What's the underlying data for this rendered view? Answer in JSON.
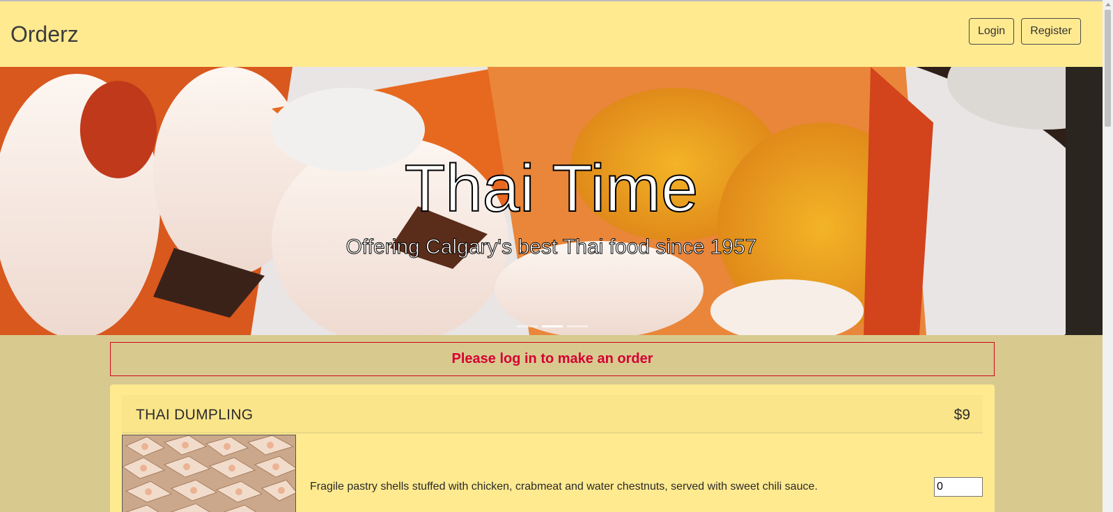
{
  "navbar": {
    "brand": "Orderz",
    "login_label": "Login",
    "register_label": "Register"
  },
  "hero": {
    "title": "Thai Time",
    "subtitle": "Offering Calgary's best Thai food since 1957",
    "slide_count": 3,
    "active_slide": 2
  },
  "alert": {
    "message": "Please log in to make an order"
  },
  "menu": {
    "items": [
      {
        "name": "THAI DUMPLING",
        "price": "$9",
        "description": "Fragile pastry shells stuffed with chicken, crabmeat and water chestnuts, served with sweet chili sauce.",
        "quantity": "0"
      }
    ]
  },
  "colors": {
    "navbar_bg": "#ffea90",
    "page_bg": "#d8ca8f",
    "alert_text": "#d50032",
    "alert_border": "#d0021b"
  }
}
